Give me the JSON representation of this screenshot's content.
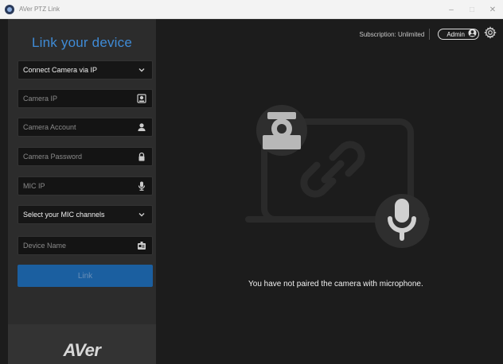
{
  "app": {
    "title": "AVer PTZ Link"
  },
  "window_controls": {
    "minimize": "–",
    "maximize": "□",
    "close": "✕"
  },
  "sidebar": {
    "title": "Link your device",
    "connect_select": "Connect Camera via IP",
    "camera_ip_placeholder": "Camera IP",
    "camera_account_placeholder": "Camera Account",
    "camera_password_placeholder": "Camera Password",
    "mic_ip_placeholder": "MIC IP",
    "mic_channels_select": "Select your MIC channels",
    "device_name_placeholder": "Device Name",
    "link_button": "Link",
    "brand": "AVer"
  },
  "header": {
    "subscription": "Subscription: Unlimited",
    "admin": "Admin"
  },
  "main": {
    "message": "You have not paired the camera with microphone."
  },
  "colors": {
    "accent": "#3f8bd6",
    "link_button": "#1b5fa0",
    "sidebar_bg": "#2c2c2c",
    "main_bg": "#1c1c1c"
  }
}
